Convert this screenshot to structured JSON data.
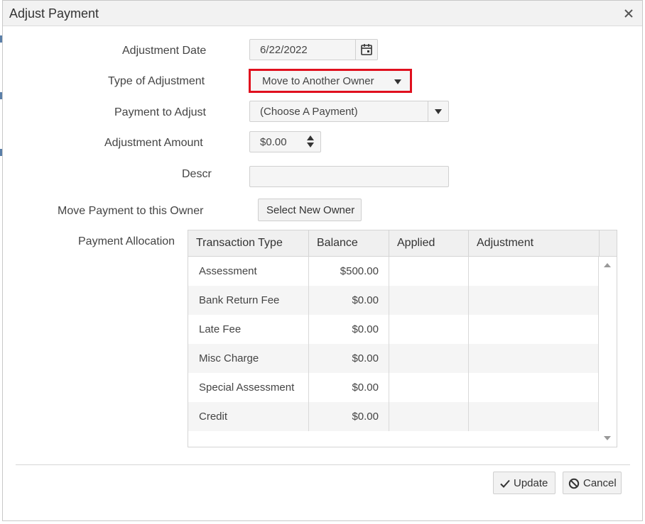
{
  "dialog": {
    "title": "Adjust Payment"
  },
  "form": {
    "adjustment_date_label": "Adjustment Date",
    "adjustment_date_value": "6/22/2022",
    "type_label": "Type of Adjustment",
    "type_value": "Move to Another Owner",
    "payment_label": "Payment to Adjust",
    "payment_value": "(Choose A Payment)",
    "amount_label": "Adjustment Amount",
    "amount_value": "$0.00",
    "descr_label": "Descr",
    "descr_value": "",
    "move_owner_label": "Move Payment to this Owner",
    "select_owner_button": "Select New Owner",
    "allocation_label": "Payment Allocation"
  },
  "grid": {
    "columns": [
      "Transaction Type",
      "Balance",
      "Applied",
      "Adjustment"
    ],
    "rows": [
      {
        "type": "Assessment",
        "balance": "$500.00",
        "applied": "",
        "adjustment": ""
      },
      {
        "type": "Bank Return Fee",
        "balance": "$0.00",
        "applied": "",
        "adjustment": ""
      },
      {
        "type": "Late Fee",
        "balance": "$0.00",
        "applied": "",
        "adjustment": ""
      },
      {
        "type": "Misc Charge",
        "balance": "$0.00",
        "applied": "",
        "adjustment": ""
      },
      {
        "type": "Special Assessment",
        "balance": "$0.00",
        "applied": "",
        "adjustment": ""
      },
      {
        "type": "Credit",
        "balance": "$0.00",
        "applied": "",
        "adjustment": ""
      }
    ]
  },
  "footer": {
    "update_label": "Update",
    "cancel_label": "Cancel"
  },
  "icons": {
    "close": "close-icon",
    "calendar": "calendar-icon",
    "dropdown": "chevron-down-icon",
    "spinner": "stepper-icon",
    "check": "check-icon",
    "ban": "ban-icon"
  },
  "colors": {
    "highlight": "#e0101e",
    "header_bg": "#f2f2f2"
  }
}
